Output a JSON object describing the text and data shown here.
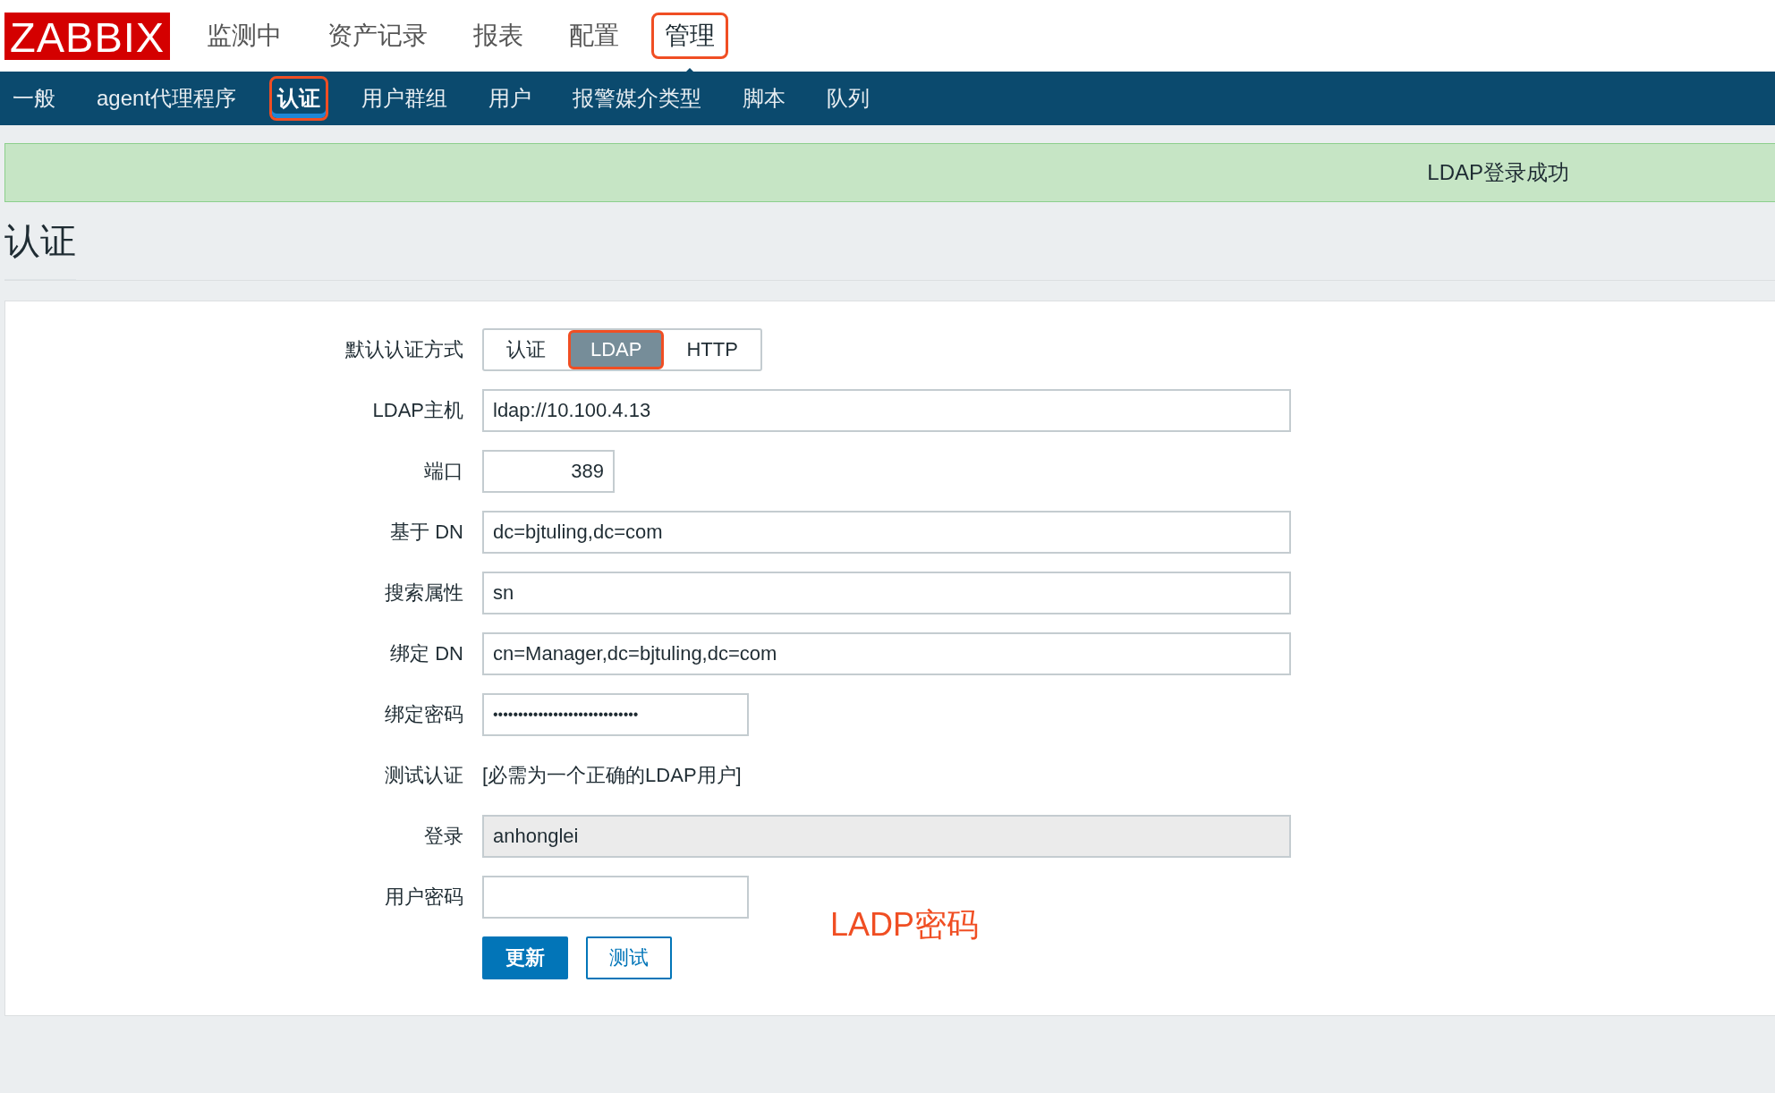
{
  "logo": "ZABBIX",
  "main_menu": [
    {
      "label": "监测中",
      "selected": false,
      "highlighted": false
    },
    {
      "label": "资产记录",
      "selected": false,
      "highlighted": false
    },
    {
      "label": "报表",
      "selected": false,
      "highlighted": false
    },
    {
      "label": "配置",
      "selected": false,
      "highlighted": false
    },
    {
      "label": "管理",
      "selected": true,
      "highlighted": true
    }
  ],
  "sub_menu": [
    {
      "label": "一般",
      "selected": false,
      "highlighted": false
    },
    {
      "label": "agent代理程序",
      "selected": false,
      "highlighted": false
    },
    {
      "label": "认证",
      "selected": true,
      "highlighted": true
    },
    {
      "label": "用户群组",
      "selected": false,
      "highlighted": false
    },
    {
      "label": "用户",
      "selected": false,
      "highlighted": false
    },
    {
      "label": "报警媒介类型",
      "selected": false,
      "highlighted": false
    },
    {
      "label": "脚本",
      "selected": false,
      "highlighted": false
    },
    {
      "label": "队列",
      "selected": false,
      "highlighted": false
    }
  ],
  "message": {
    "kind": "success",
    "text": "LDAP登录成功"
  },
  "page_title": "认证",
  "form": {
    "rows": [
      {
        "kind": "segmented",
        "label": "默认认证方式",
        "options": [
          {
            "label": "认证",
            "selected": false,
            "highlighted": false
          },
          {
            "label": "LDAP",
            "selected": true,
            "highlighted": true
          },
          {
            "label": "HTTP",
            "selected": false,
            "highlighted": false
          }
        ]
      },
      {
        "kind": "text",
        "label": "LDAP主机",
        "value": "ldap://10.100.4.13"
      },
      {
        "kind": "number",
        "label": "端口",
        "value": "389"
      },
      {
        "kind": "text",
        "label": "基于 DN",
        "value": "dc=bjtuling,dc=com"
      },
      {
        "kind": "text",
        "label": "搜索属性",
        "value": "sn"
      },
      {
        "kind": "text",
        "label": "绑定 DN",
        "value": "cn=Manager,dc=bjtuling,dc=com"
      },
      {
        "kind": "password",
        "label": "绑定密码",
        "value": "•••••••••••••••••••••••••••••"
      },
      {
        "kind": "note",
        "label": "测试认证",
        "value": "[必需为一个正确的LDAP用户]"
      },
      {
        "kind": "readonly",
        "label": "登录",
        "value": "anhonglei"
      },
      {
        "kind": "password",
        "label": "用户密码"
      }
    ],
    "buttons": [
      {
        "kind": "primary",
        "label": "更新"
      },
      {
        "kind": "secondary",
        "label": "测试"
      }
    ]
  },
  "annotation": {
    "text": "LADP密码"
  }
}
